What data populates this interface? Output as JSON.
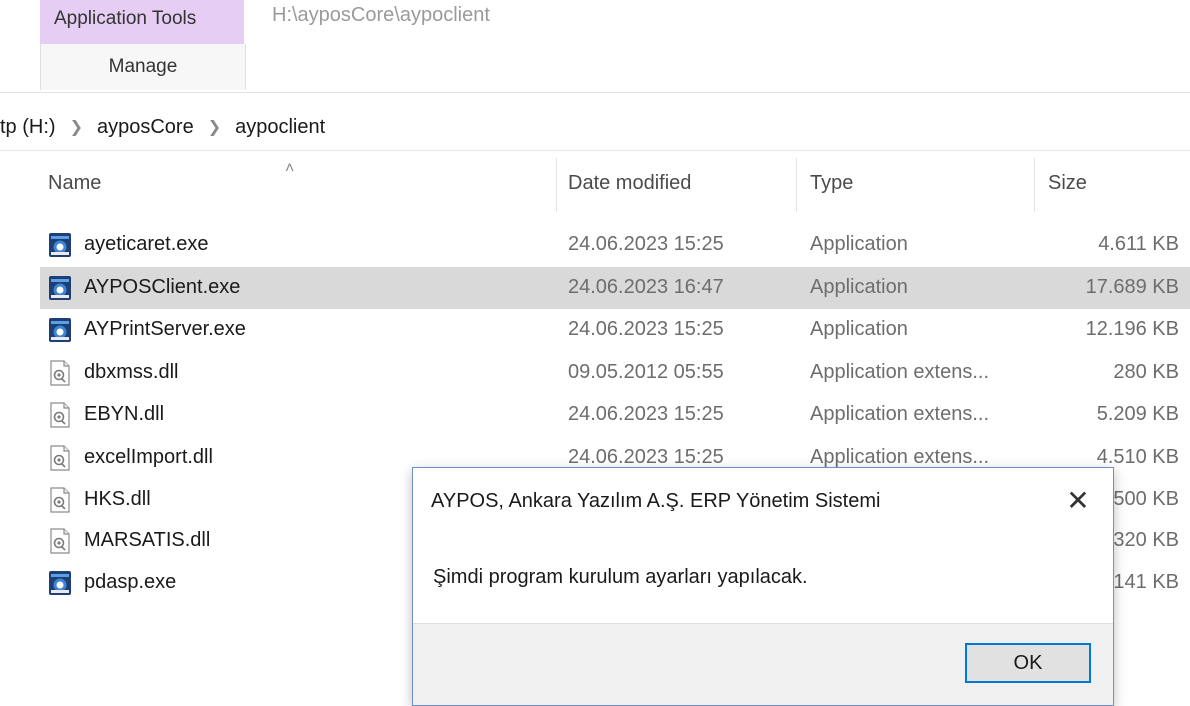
{
  "ribbon": {
    "context_group": "Application Tools",
    "context_tab": "Manage",
    "window_path": "H:\\ayposCore\\aypoclient"
  },
  "breadcrumb": [
    {
      "label": "tp (H:)"
    },
    {
      "label": "ayposCore"
    },
    {
      "label": "aypoclient"
    }
  ],
  "columns": {
    "name": "Name",
    "date": "Date modified",
    "type": "Type",
    "size": "Size"
  },
  "files": [
    {
      "name": "ayeticaret.exe",
      "date": "24.06.2023 15:25",
      "type": "Application",
      "size": "4.611 KB",
      "icon": "exe-icon",
      "selected": false
    },
    {
      "name": "AYPOSClient.exe",
      "date": "24.06.2023 16:47",
      "type": "Application",
      "size": "17.689 KB",
      "icon": "exe-icon",
      "selected": true
    },
    {
      "name": "AYPrintServer.exe",
      "date": "24.06.2023 15:25",
      "type": "Application",
      "size": "12.196 KB",
      "icon": "exe-icon",
      "selected": false
    },
    {
      "name": "dbxmss.dll",
      "date": "09.05.2012 05:55",
      "type": "Application extens...",
      "size": "280 KB",
      "icon": "dll-icon",
      "selected": false
    },
    {
      "name": "EBYN.dll",
      "date": "24.06.2023 15:25",
      "type": "Application extens...",
      "size": "5.209 KB",
      "icon": "dll-icon",
      "selected": false
    },
    {
      "name": "excelImport.dll",
      "date": "24.06.2023 15:25",
      "type": "Application extens...",
      "size": "4.510 KB",
      "icon": "dll-icon",
      "selected": false
    },
    {
      "name": "HKS.dll",
      "date": "",
      "type": "",
      "size": "500 KB",
      "icon": "dll-icon",
      "selected": false
    },
    {
      "name": "MARSATIS.dll",
      "date": "",
      "type": "",
      "size": "320 KB",
      "icon": "dll-icon",
      "selected": false
    },
    {
      "name": "pdasp.exe",
      "date": "",
      "type": "",
      "size": "141 KB",
      "icon": "exe-icon",
      "selected": false
    }
  ],
  "dialog": {
    "title": "AYPOS, Ankara Yazılım A.Ş. ERP Yönetim Sistemi",
    "message": "Şimdi program kurulum ayarları yapılacak.",
    "ok_label": "OK",
    "close_icon": "close-icon"
  },
  "colors": {
    "context_tab_bg": "#e5cdf3",
    "selected_row_bg": "#d9d9d9",
    "button_focus_border": "#0078d7",
    "dialog_border": "#6f8fc9"
  }
}
